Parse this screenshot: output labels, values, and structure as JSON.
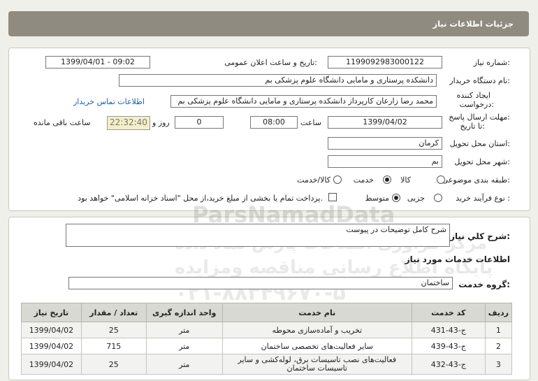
{
  "header": {
    "title": "جزئیات اطلاعات نیاز"
  },
  "fields": {
    "need_number_label": "شماره نیاز:",
    "need_number": "1199092983000122",
    "announce_label": "تاریخ و ساعت اعلان عمومی:",
    "announce_value": "1399/04/01 - 09:02",
    "buyer_org_label": "نام دستگاه خریدار:",
    "buyer_org": "دانشکده پرستاری و مامایی دانشگاه علوم پزشکی بم",
    "requester_label_1": "ایجاد کننده",
    "requester_label_2": "درخواست:",
    "requester": "محمد رضا  زارعان  کارپرداز دانشکده پرستاری و مامایی دانشگاه علوم پزشکی بم",
    "contact_link": "اطلاعات تماس خریدار",
    "deadline_label_1": "مهلت ارسال پاسخ:",
    "deadline_label_2": "تا تاریخ:",
    "deadline_date": "1399/04/02",
    "time_label": "ساعت",
    "deadline_time": "08:00",
    "days_value": "0",
    "days_label": "روز و",
    "remaining_time": "22:32:40",
    "remaining_label": "ساعت باقی مانده",
    "province_label": "استان محل تحویل:",
    "province": "کرمان",
    "city_label": "شهر محل تحویل:",
    "city": "بم",
    "category_label": "طبقه بندی موضوعی:",
    "category_options": [
      "کالا",
      "خدمت",
      "کالا/خدمت"
    ],
    "process_label": "نوع فرآیند خرید :",
    "process_options": [
      "جزیی",
      "متوسط"
    ],
    "payment_note": "پرداخت تمام یا بخشی از مبلغ خرید،از محل \"اسناد خزانه اسلامی\" خواهد بود."
  },
  "description": {
    "label": "شرح كلي نياز:",
    "value": "شرح کامل توضیحات در پیوست"
  },
  "services": {
    "section_title": "اطلاعات خدمات مورد نیاز",
    "group_label": "گروه خدمت:",
    "group_value": "ساختمان",
    "columns": [
      "ردیف",
      "کد خدمت",
      "نام خدمت",
      "واحد اندازه گیری",
      "تعداد / مقدار",
      "تاریخ نیاز"
    ],
    "rows": [
      {
        "row": "1",
        "code": "ج-43-431",
        "name": "تخریب و آماده‌سازی محوطه",
        "unit": "متر",
        "qty": "25",
        "date": "1399/04/02"
      },
      {
        "row": "2",
        "code": "ج-43-439",
        "name": "سایر فعالیت‌های تخصصی ساختمان",
        "unit": "متر",
        "qty": "715",
        "date": "1399/04/02"
      },
      {
        "row": "3",
        "code": "ج-43-432",
        "name": "فعالیت‌های نصب تاسیسات برق، لوله‌کشی و سایر تاسیسات ساختمان",
        "unit": "متر",
        "qty": "25",
        "date": "1399/04/02"
      }
    ]
  },
  "watermark": {
    "brand": "ParsNamadData",
    "line1": "مرکز فراوری اطلاعات پارس نماد داده",
    "line2": "پایگاه اطلاع رسانی مناقصه ومزایده",
    "phone": "۰۲۱-۸۸۳۴۹۶۷۰-۵"
  }
}
